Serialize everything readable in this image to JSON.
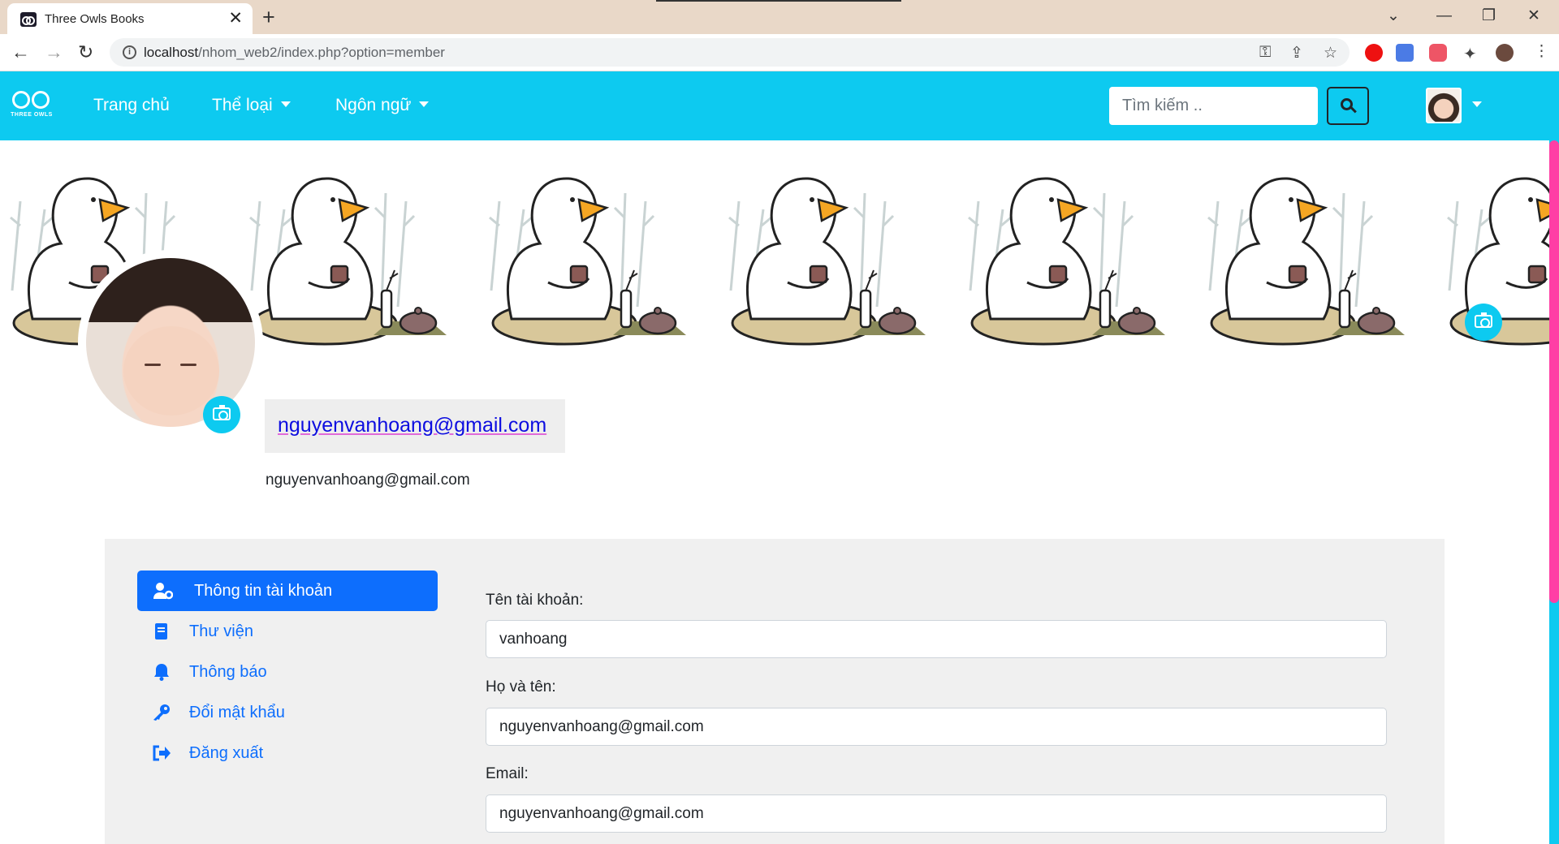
{
  "browser": {
    "tab_title": "Three Owls Books",
    "url_host": "localhost",
    "url_path": "/nhom_web2/index.php?option=member"
  },
  "navbar": {
    "logo_text": "THREE OWLS",
    "links": [
      "Trang chủ",
      "Thể loại",
      "Ngôn ngữ"
    ],
    "search_placeholder": "Tìm kiếm .."
  },
  "profile": {
    "display_name": "nguyenvanhoang@gmail.com",
    "email": "nguyenvanhoang@gmail.com"
  },
  "menu": [
    {
      "label": "Thông tin tài khoản",
      "icon": "user-cog-icon",
      "active": true
    },
    {
      "label": "Thư viện",
      "icon": "book-icon"
    },
    {
      "label": "Thông báo",
      "icon": "bell-icon"
    },
    {
      "label": "Đổi mật khẩu",
      "icon": "key-icon"
    },
    {
      "label": "Đăng xuất",
      "icon": "sign-out-icon"
    }
  ],
  "form": {
    "username_label": "Tên tài khoản:",
    "username_value": "vanhoang",
    "fullname_label": "Họ và tên:",
    "fullname_value": "nguyenvanhoang@gmail.com",
    "email_label": "Email:",
    "email_value": "nguyenvanhoang@gmail.com"
  },
  "colors": {
    "navbar": "#0dcaf0",
    "primary": "#0d6efd",
    "panel": "#f0f0f0"
  }
}
